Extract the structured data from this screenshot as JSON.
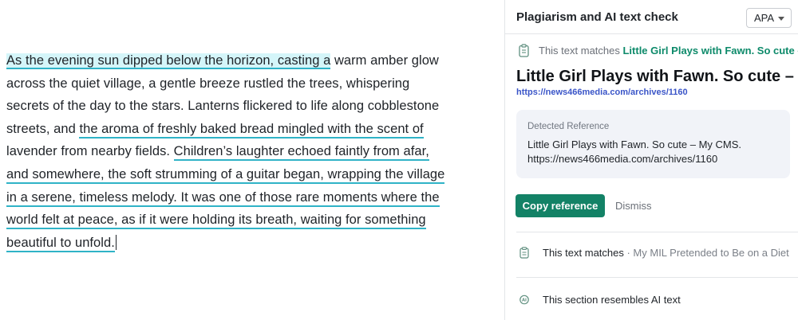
{
  "document": {
    "segments": [
      {
        "text": "As the evening sun dipped below the horizon, casting a",
        "style": "active"
      },
      {
        "text": " warm amber glow across the quiet village, a gentle breeze rustled the trees, whispering secrets of the day to the stars. Lanterns flickered to life along cobblestone streets, and ",
        "style": "plain"
      },
      {
        "text": "the aroma of freshly baked bread mingled with the scent of",
        "style": "underline"
      },
      {
        "text": " lavender from nearby fields. ",
        "style": "plain"
      },
      {
        "text": "Children’s laughter echoed faintly from afar, and somewhere, the soft strumming of a guitar began, wrapping the village in a serene, timeless melody. It was one of those rare moments where the world felt at peace, as if it were holding its breath, waiting for something beautiful to unfold.",
        "style": "underline"
      }
    ]
  },
  "panel": {
    "title": "Plagiarism and AI text check",
    "citation_style": "APA",
    "match": {
      "label": "This text matches ",
      "source": "Little Girl Plays with Fawn. So cute – My CMS"
    },
    "source_title": "Little Girl Plays with Fawn. So cute – My CMS",
    "source_url": "https://news466media.com/archives/1160",
    "reference": {
      "heading": "Detected Reference",
      "line1": "Little Girl Plays with Fawn. So cute – My CMS.",
      "line2": "https://news466media.com/archives/1160"
    },
    "copy_label": "Copy reference",
    "dismiss_label": "Dismiss",
    "items": [
      {
        "label": "This text matches",
        "meta": " · My MIL Pretended to Be on a Diet"
      },
      {
        "label": "This section resembles AI text",
        "meta": ""
      }
    ]
  },
  "colors": {
    "accent_green": "#138266",
    "highlight_teal": "#2fb3c7",
    "highlight_bg": "#d4f5f9",
    "link_blue": "#3a55c8"
  }
}
